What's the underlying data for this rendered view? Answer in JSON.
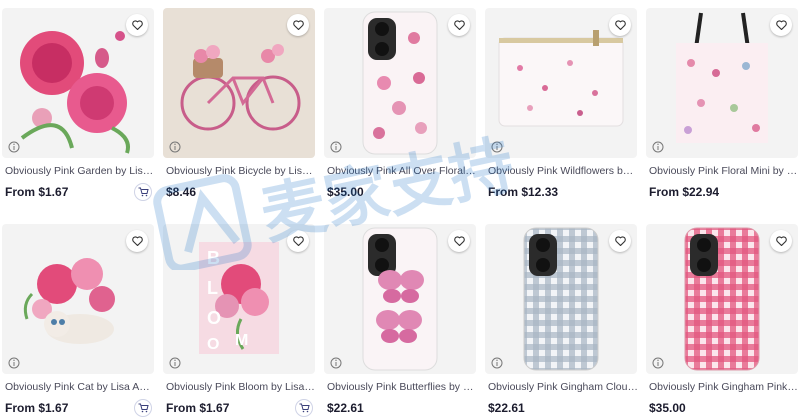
{
  "products": [
    {
      "title": "Obviously Pink Garden by Lisa A...",
      "price": "From $1.67",
      "thumb": "sticker-garden",
      "cart": true
    },
    {
      "title": "Obviously Pink Bicycle by Lisa A...",
      "price": "$8.46",
      "thumb": "bicycle",
      "cart": false
    },
    {
      "title": "Obviously Pink All Over Floral by ...",
      "price": "$35.00",
      "thumb": "phone-floral",
      "cart": false
    },
    {
      "title": "Obviously Pink Wildflowers by Li...",
      "price": "From $12.33",
      "thumb": "pouch",
      "cart": false
    },
    {
      "title": "Obviously Pink Floral Mini by Lis...",
      "price": "From $22.94",
      "thumb": "tote",
      "cart": false
    },
    {
      "title": "Obviously Pink Cat by Lisa Audit ...",
      "price": "From $1.67",
      "thumb": "sticker-cat",
      "cart": true
    },
    {
      "title": "Obviously Pink Bloom by Lisa Au...",
      "price": "From $1.67",
      "thumb": "bloom",
      "cart": true
    },
    {
      "title": "Obviously Pink Butterflies by Lis...",
      "price": "$22.61",
      "thumb": "phone-butterfly",
      "cart": false
    },
    {
      "title": "Obviously Pink Gingham Cloudy ...",
      "price": "$22.61",
      "thumb": "phone-gingham-gray",
      "cart": false
    },
    {
      "title": "Obviously Pink Gingham Pink La...",
      "price": "$35.00",
      "thumb": "phone-gingham-pink",
      "cart": false
    }
  ],
  "bloom_letters": [
    "B",
    "L",
    "O",
    "O",
    "M"
  ],
  "watermark_text": "麦家支持",
  "icons": {
    "favorite": "heart-icon",
    "info": "info-icon",
    "cart": "add-to-cart-icon"
  },
  "colors": {
    "accent": "#1a73c8",
    "text": "#4a4a5a",
    "price": "#1c1c2e"
  }
}
